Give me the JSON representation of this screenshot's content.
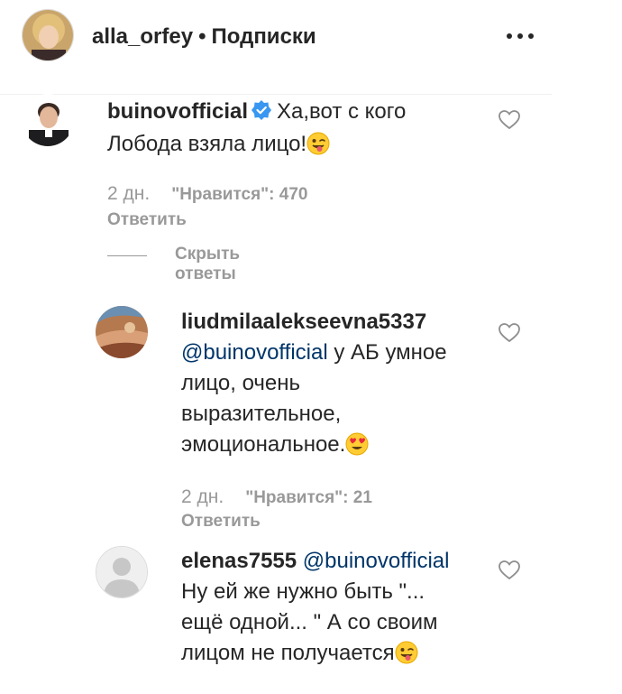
{
  "header": {
    "username": "alla_orfey",
    "separator": "•",
    "follow_label": "Подписки",
    "more_icon": "more-horizontal-icon"
  },
  "comments": [
    {
      "username": "buinovofficial",
      "verified": true,
      "text_line1": "Ха,вот с кого",
      "text_line2": "Лобода взяла лицо!",
      "emoji": "winking-tongue-emoji",
      "time": "2 дн.",
      "likes_label": "\"Нравится\": 470",
      "reply_label": "Ответить",
      "hide_replies_label": "Скрыть ответы"
    },
    {
      "username": "liudmilaalekseevna5337",
      "mention": "@buinovofficial",
      "text_line1": " у АБ умное",
      "text_line2": "лицо, очень",
      "text_line3": "выразительное,",
      "text_line4": "эмоциональное.",
      "emoji": "heart-eyes-emoji",
      "time": "2 дн.",
      "likes_label": "\"Нравится\": 21",
      "reply_label": "Ответить"
    },
    {
      "username": "elenas7555",
      "mention": "@buinovofficial",
      "text_line1": "Ну ей же нужно быть \"...",
      "text_line2": "ещё одной... \" А со своим",
      "text_line3": "лицом не получается",
      "emoji": "winking-tongue-emoji"
    }
  ],
  "colors": {
    "text": "#262626",
    "muted": "#999999",
    "mention": "#003569",
    "verified": "#3897f0"
  }
}
